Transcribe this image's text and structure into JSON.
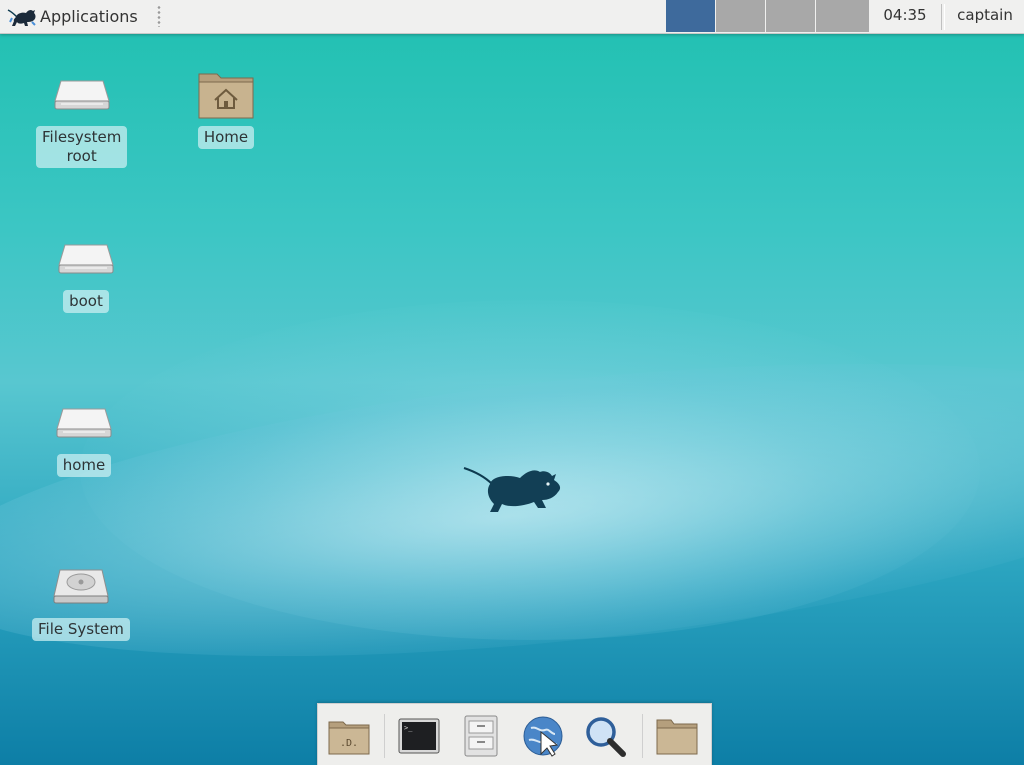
{
  "panel": {
    "applications_label": "Applications",
    "clock": "04:35",
    "user": "captain",
    "workspace_active_color": "#3e6a9c",
    "workspace_inactive_color": "#a8a8a8"
  },
  "desktop_icons": [
    {
      "label_line1": "Filesystem",
      "label_line2": "root",
      "icon": "drive-icon"
    },
    {
      "label": "Home",
      "icon": "home-folder-icon"
    },
    {
      "label": "boot",
      "icon": "drive-icon"
    },
    {
      "label": "home",
      "icon": "drive-icon"
    },
    {
      "label": "File System",
      "icon": "harddisk-icon"
    }
  ],
  "dock": {
    "items": [
      "show-desktop-icon",
      "terminal-icon",
      "file-manager-icon",
      "web-browser-icon",
      "search-icon",
      "folder-icon"
    ]
  },
  "colors": {
    "accent": "#3e6a9c",
    "desktop_teal": "#1fc0b0",
    "desktop_blue": "#0d7ea6"
  }
}
